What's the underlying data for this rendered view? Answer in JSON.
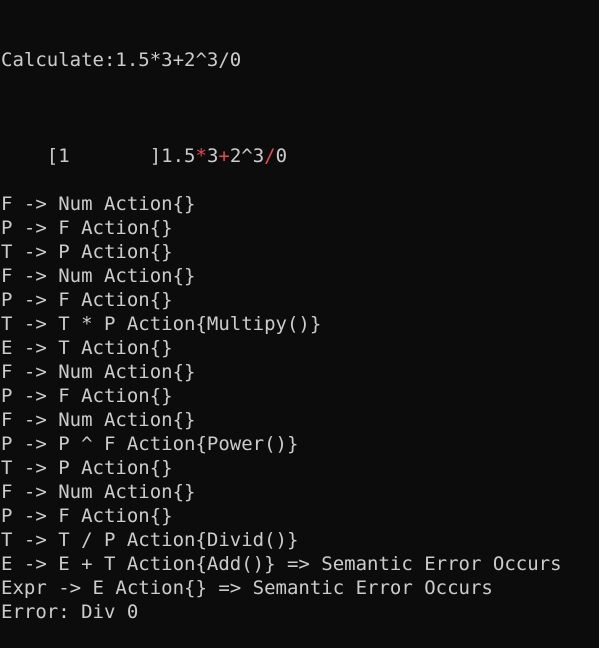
{
  "console": {
    "first_line": "Calculate:1.5*3+2^3/0",
    "highlight": {
      "prefix": "[1       ]1.5",
      "segments": [
        {
          "text": "*",
          "color": "#e74856"
        },
        {
          "text": "3",
          "color": "#cccccc"
        },
        {
          "text": "+",
          "color": "#e74856"
        },
        {
          "text": "2^3",
          "color": "#cccccc"
        },
        {
          "text": "/",
          "color": "#e74856"
        },
        {
          "text": "0",
          "color": "#cccccc"
        }
      ]
    },
    "lines": [
      "F -> Num Action{}",
      "P -> F Action{}",
      "T -> P Action{}",
      "F -> Num Action{}",
      "P -> F Action{}",
      "T -> T * P Action{Multipy()}",
      "E -> T Action{}",
      "F -> Num Action{}",
      "P -> F Action{}",
      "F -> Num Action{}",
      "P -> P ^ F Action{Power()}",
      "T -> P Action{}",
      "F -> Num Action{}",
      "P -> F Action{}",
      "T -> T / P Action{Divid()}",
      "E -> E + T Action{Add()} => Semantic Error Occurs",
      "Expr -> E Action{} => Semantic Error Occurs",
      "Error: Div 0"
    ]
  }
}
